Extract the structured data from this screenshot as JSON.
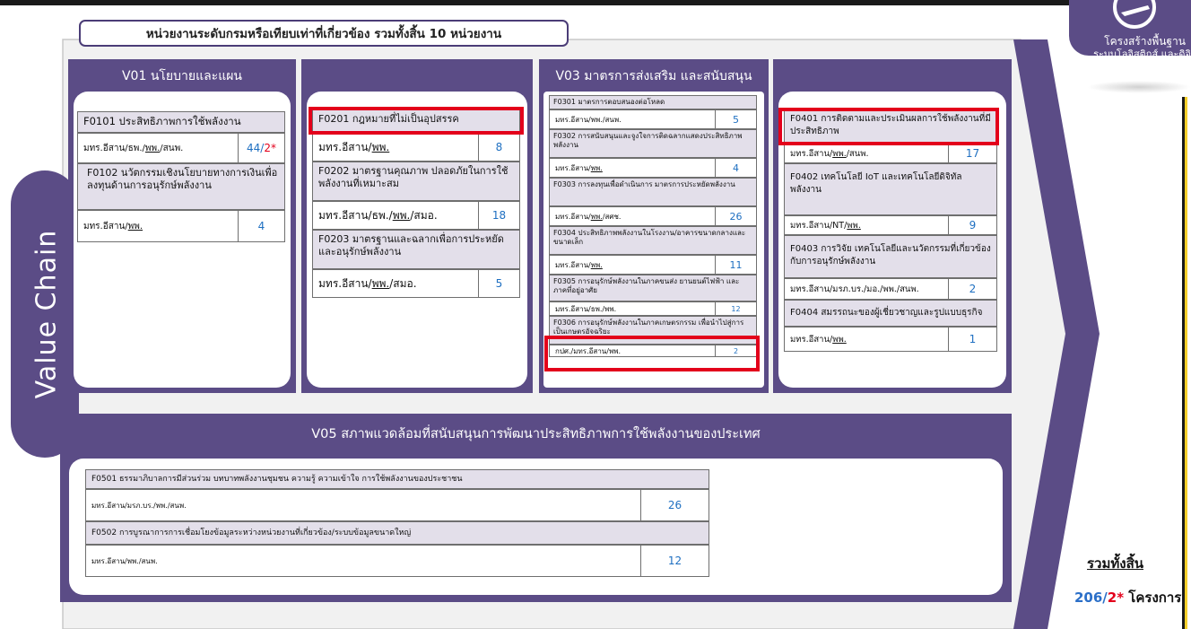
{
  "header": {
    "title": "หน่วยงานระดับกรมหรือเทียบเท่าที่เกี่ยวข้อง รวมทั้งสิ้น 10 หน่วยงาน"
  },
  "value_chain_label": "Value Chain",
  "logo": {
    "line1": "โครงสร้างพื้นฐาน",
    "line2": "ระบบโลจิสติกส์ และดิจิ"
  },
  "colors": {
    "purple": "#5b4c86",
    "highlight": "#e3001b",
    "number": "#1e6fc1"
  },
  "v01": {
    "title": "V01 นโยบายและแผน",
    "f0101": {
      "title": "F0101 ประสิทธิภาพการใช้พลังงาน",
      "agencies_pre": "มทร.อีสาน/ธพ./",
      "agencies_u": "พพ.",
      "agencies_post": "/สนพ.",
      "count_blue": "44/",
      "count_red": "2*"
    },
    "f0102": {
      "title": "F0102 นวัตกรรมเชิงนโยบายทางการเงินเพื่อลงทุนด้านการอนุรักษ์พลังงาน",
      "agencies_pre": "มทร.อีสาน/",
      "agencies_u": "พพ.",
      "count": "4"
    }
  },
  "v02": {
    "f0201": {
      "title": "F0201 กฎหมายที่ไม่เป็นอุปสรรค",
      "agencies_pre": "มทร.อีสาน/",
      "agencies_u": "พพ.",
      "count": "8"
    },
    "f0202": {
      "title": "F0202 มาตรฐานคุณภาพ ปลอดภัยในการใช้พลังงานที่เหมาะสม",
      "agencies_pre": "มทร.อีสาน/ธพ./",
      "agencies_u": "พพ.",
      "agencies_post": "/สมอ.",
      "count": "18"
    },
    "f0203": {
      "title": "F0203 มาตรฐานและฉลากเพื่อการประหยัดและอนุรักษ์พลังงาน",
      "agencies_pre": "มทร.อีสาน/",
      "agencies_u": "พพ.",
      "agencies_post": "/สมอ.",
      "count": "5"
    }
  },
  "v03": {
    "title": "V03 มาตรการส่งเสริม และสนับสนุน",
    "f0301": {
      "title": "F0301 มาตรการตอบสนองต่อโหลด",
      "agencies": "มทร.อีสาน/พพ./สนพ.",
      "count": "5"
    },
    "f0302": {
      "title": "F0302 การสนับสนุนและจูงใจการติดฉลากแสดงประสิทธิภาพพลังงาน",
      "agencies_pre": "มทร.อีสาน/",
      "agencies_u": "พพ.",
      "count": "4"
    },
    "f0303": {
      "title": "F0303 การลงทุนเพื่อดำเนินการ มาตรการประหยัดพลังงาน",
      "agencies_pre": "มทร.อีสาน/",
      "agencies_u": "พพ.",
      "agencies_post": "/สศช.",
      "count": "26"
    },
    "f0304": {
      "title": "F0304 ประสิทธิภาพพลังงานในโรงงาน/อาคารขนาดกลางและขนาดเล็ก",
      "agencies_pre": "มทร.อีสาน/",
      "agencies_u": "พพ.",
      "count": "11"
    },
    "f0305": {
      "title": "F0305 การอนุรักษ์พลังงานในภาคขนส่ง ยานยนต์ไฟฟ้า และภาคที่อยู่อาศัย",
      "agencies": "มทร.อีสาน/ธพ./พพ.",
      "count": "12"
    },
    "f0306": {
      "title": "F0306 การอนุรักษ์พลังงานในภาคเกษตรกรรม เพื่อนำไปสู่การเป็นเกษตรอัจฉริยะ",
      "agencies": "กปศ./มทร.อีสาน/พพ.",
      "count": "2"
    }
  },
  "v04": {
    "f0401": {
      "title": "F0401 การติดตามและประเมินผลการใช้พลังงานที่มีประสิทธิภาพ",
      "agencies_pre": "มทร.อีสาน/",
      "agencies_u": "พพ.",
      "agencies_post": "/สนพ.",
      "count": "17"
    },
    "f0402": {
      "title": "F0402 เทคโนโลยี IoT และเทคโนโลยีดิจิทัลพลังงาน",
      "agencies_pre": "มทร.อีสาน/NT/",
      "agencies_u": "พพ.",
      "count": "9"
    },
    "f0403": {
      "title": "F0403 การวิจัย เทคโนโลยีและนวัตกรรมที่เกี่ยวข้องกับการอนุรักษ์พลังงาน",
      "agencies": "มทร.อีสาน/มรภ.บร./มอ./พพ./สนพ.",
      "count": "2"
    },
    "f0404": {
      "title": "F0404 สมรรถนะของผู้เชี่ยวชาญและรูปแบบธุรกิจ",
      "agencies_pre": "มทร.อีสาน/",
      "agencies_u": "พพ.",
      "count": "1"
    }
  },
  "v05": {
    "title": "V05 สภาพแวดล้อมที่สนับสนุนการพัฒนาประสิทธิภาพการใช้พลังงานของประเทศ",
    "f0501": {
      "title": "F0501 ธรรมาภิบาลการมีส่วนร่วม บทบาทพลังงานชุมชน ความรู้ ความเข้าใจ การใช้พลังงานของประชาชน",
      "agencies": "มทร.อีสาน/มรภ.บร./พพ./สนพ.",
      "count": "26"
    },
    "f0502": {
      "title": "F0502 การบูรณาการการเชื่อมโยงข้อมูลระหว่างหน่วยงานที่เกี่ยวข้อง/ระบบข้อมูลขนาดใหญ่",
      "agencies": "มทร.อีสาน/พพ./สนพ.",
      "count": "12"
    }
  },
  "total": {
    "label": "รวมทั้งสิ้น",
    "value_blue": "206/",
    "value_red": "2*",
    "suffix": " โครงการ"
  }
}
